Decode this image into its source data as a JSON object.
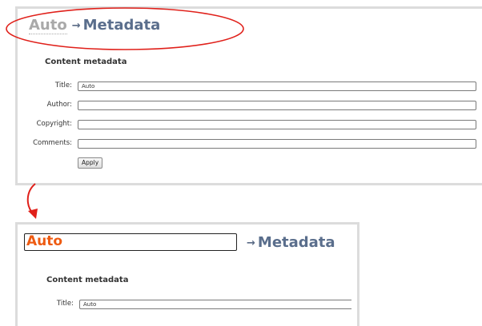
{
  "top_panel": {
    "breadcrumb": {
      "part1": "Auto",
      "arrow": "→",
      "part2": "Metadata"
    },
    "section_title": "Content metadata",
    "fields": [
      {
        "label": "Title:",
        "value": "Auto"
      },
      {
        "label": "Author:",
        "value": ""
      },
      {
        "label": "Copyright:",
        "value": ""
      },
      {
        "label": "Comments:",
        "value": ""
      }
    ],
    "apply_label": "Apply"
  },
  "bottom_panel": {
    "breadcrumb": {
      "part1": "Auto",
      "arrow": "→",
      "part2": "Metadata"
    },
    "section_title": "Content metadata",
    "fields": [
      {
        "label": "Title:",
        "value": "Auto"
      }
    ]
  },
  "colors": {
    "annotation_red": "#e0201a",
    "editable_text_orange": "#ee5b12",
    "breadcrumb_blue": "#5a6e8c"
  }
}
